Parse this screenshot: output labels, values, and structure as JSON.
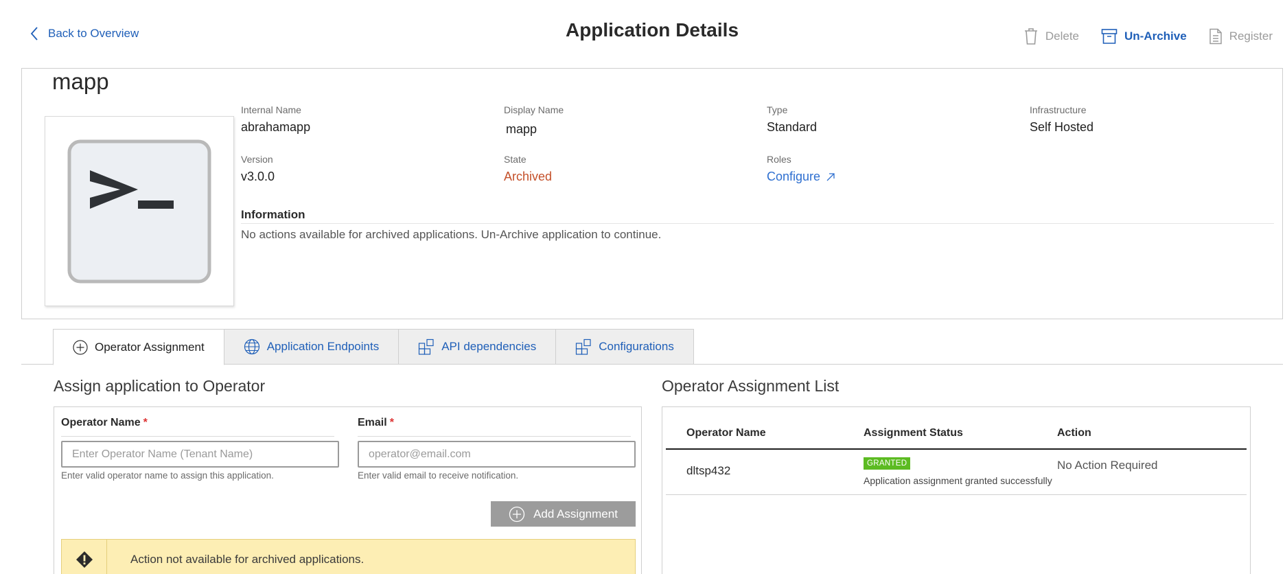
{
  "header": {
    "back_label": "Back to Overview",
    "title": "Application Details",
    "actions": [
      {
        "label": "Delete",
        "icon": "trash-icon",
        "state": "disabled"
      },
      {
        "label": "Un-Archive",
        "icon": "archive-box-icon",
        "state": "active"
      },
      {
        "label": "Register",
        "icon": "document-icon",
        "state": "disabled"
      }
    ]
  },
  "app": {
    "name": "mapp",
    "icon": "terminal-prompt-icon",
    "fields": {
      "internal_name": {
        "label": "Internal Name",
        "value": "abrahamapp"
      },
      "display_name": {
        "label": "Display Name",
        "value": "mapp"
      },
      "type": {
        "label": "Type",
        "value": "Standard"
      },
      "infrastructure": {
        "label": "Infrastructure",
        "value": "Self Hosted"
      },
      "version": {
        "label": "Version",
        "value": "v3.0.0"
      },
      "state": {
        "label": "State",
        "value": "Archived"
      },
      "roles": {
        "label": "Roles",
        "value": "Configure"
      }
    },
    "information_heading": "Information",
    "information_text": "No actions available for archived applications. Un-Archive application to continue."
  },
  "tabs": [
    {
      "label": "Operator Assignment",
      "icon": "plus-circle-icon",
      "active": true
    },
    {
      "label": "Application Endpoints",
      "icon": "globe-icon",
      "active": false
    },
    {
      "label": "API dependencies",
      "icon": "blocks-icon",
      "active": false
    },
    {
      "label": "Configurations",
      "icon": "blocks-icon",
      "active": false
    }
  ],
  "assign": {
    "title": "Assign application to Operator",
    "operator_label": "Operator Name",
    "operator_placeholder": "Enter Operator Name (Tenant Name)",
    "operator_hint": "Enter valid operator name to assign this application.",
    "email_label": "Email",
    "email_placeholder": "operator@email.com",
    "email_hint": "Enter valid email to receive notification.",
    "required_mark": "*",
    "add_button": "Add Assignment",
    "warning": "Action not available for archived applications."
  },
  "assignment_list": {
    "title": "Operator Assignment List",
    "columns": [
      "Operator Name",
      "Assignment Status",
      "Action"
    ],
    "rows": [
      {
        "operator": "dltsp432",
        "badge": "GRANTED",
        "status_text": "Application assignment granted successfully",
        "action": "No Action Required"
      }
    ]
  },
  "colors": {
    "link": "#1f5fb8",
    "archived": "#c4502a",
    "granted": "#5cbb22",
    "warning_bg": "#fdeeb4"
  }
}
